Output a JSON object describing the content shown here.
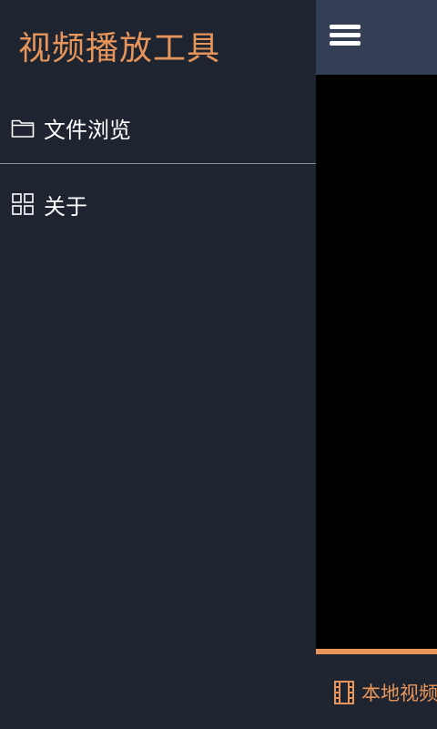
{
  "drawer": {
    "title": "视频播放工具",
    "items": [
      {
        "label": "文件浏览",
        "icon": "folder-icon"
      },
      {
        "label": "关于",
        "icon": "grid-icon"
      }
    ]
  },
  "main": {
    "topbar": {
      "menu_icon": "hamburger-menu-icon"
    },
    "bottom_tab": {
      "label": "本地视频",
      "icon": "film-icon"
    }
  },
  "colors": {
    "accent": "#e7955a",
    "drawer_bg": "#1f2530",
    "topbar_bg": "#343f55",
    "video_bg": "#000000",
    "text": "#ffffff"
  }
}
